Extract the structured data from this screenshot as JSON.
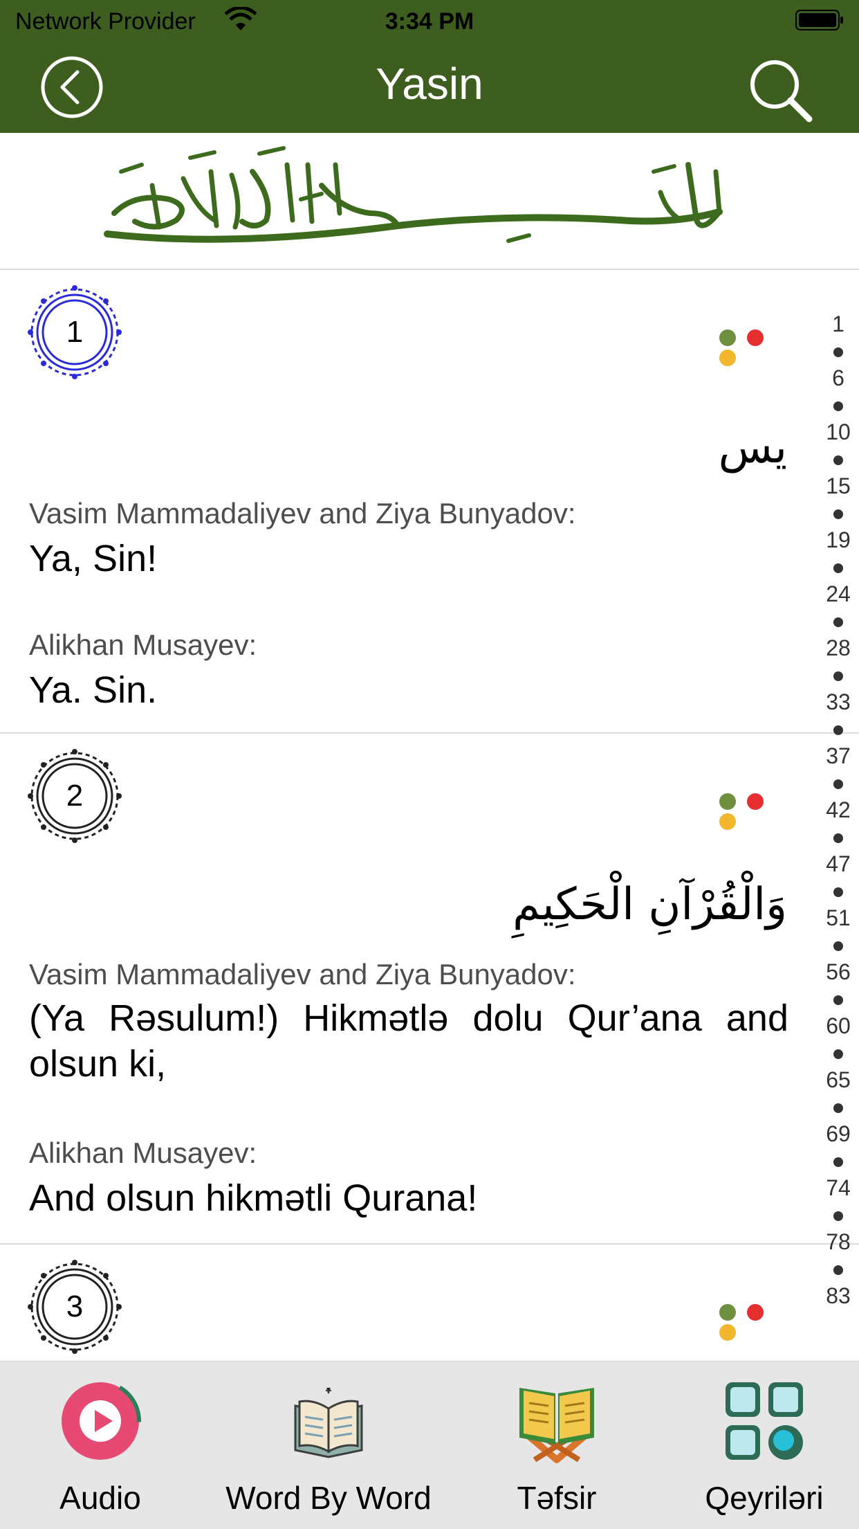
{
  "status_bar": {
    "carrier": "Network Provider",
    "time": "3:34 PM"
  },
  "nav": {
    "title": "Yasin"
  },
  "header": {
    "bismillah_icon": "bismillah-calligraphy"
  },
  "verses": [
    {
      "number": "1",
      "medal_color": "#2a2ad8",
      "arabic": "يس",
      "translations": [
        {
          "author": "Vasim Mammadaliyev and Ziya Bunyadov:",
          "text": "Ya, Sin!"
        },
        {
          "author": "Alikhan Musayev:",
          "text": "Ya. Sin."
        }
      ]
    },
    {
      "number": "2",
      "medal_color": "#222222",
      "arabic": "وَالْقُرْآنِ الْحَكِيمِ",
      "translations": [
        {
          "author": "Vasim Mammadaliyev and Ziya Bunyadov:",
          "text": "(Ya Rəsulum!) Hikmətlə dolu Qur’ana and olsun ki,"
        },
        {
          "author": "Alikhan Musayev:",
          "text": "And olsun hikmətli Qurana!"
        }
      ]
    },
    {
      "number": "3",
      "medal_color": "#222222"
    }
  ],
  "indicator_colors": [
    "#6e8f3e",
    "#e62e2e",
    "#f2b72c"
  ],
  "side_index": [
    "1",
    "6",
    "10",
    "15",
    "19",
    "24",
    "28",
    "33",
    "37",
    "42",
    "47",
    "51",
    "56",
    "60",
    "65",
    "69",
    "74",
    "78",
    "83"
  ],
  "tabs": [
    {
      "label": "Audio",
      "icon": "audio-play-icon"
    },
    {
      "label": "Word By Word",
      "icon": "book-icon"
    },
    {
      "label": "Təfsir",
      "icon": "quran-stand-icon"
    },
    {
      "label": "Qeyriləri",
      "icon": "apps-grid-icon"
    }
  ],
  "colors": {
    "brand": "#3d5e1f",
    "tabbar_bg": "#e6e6e6"
  }
}
